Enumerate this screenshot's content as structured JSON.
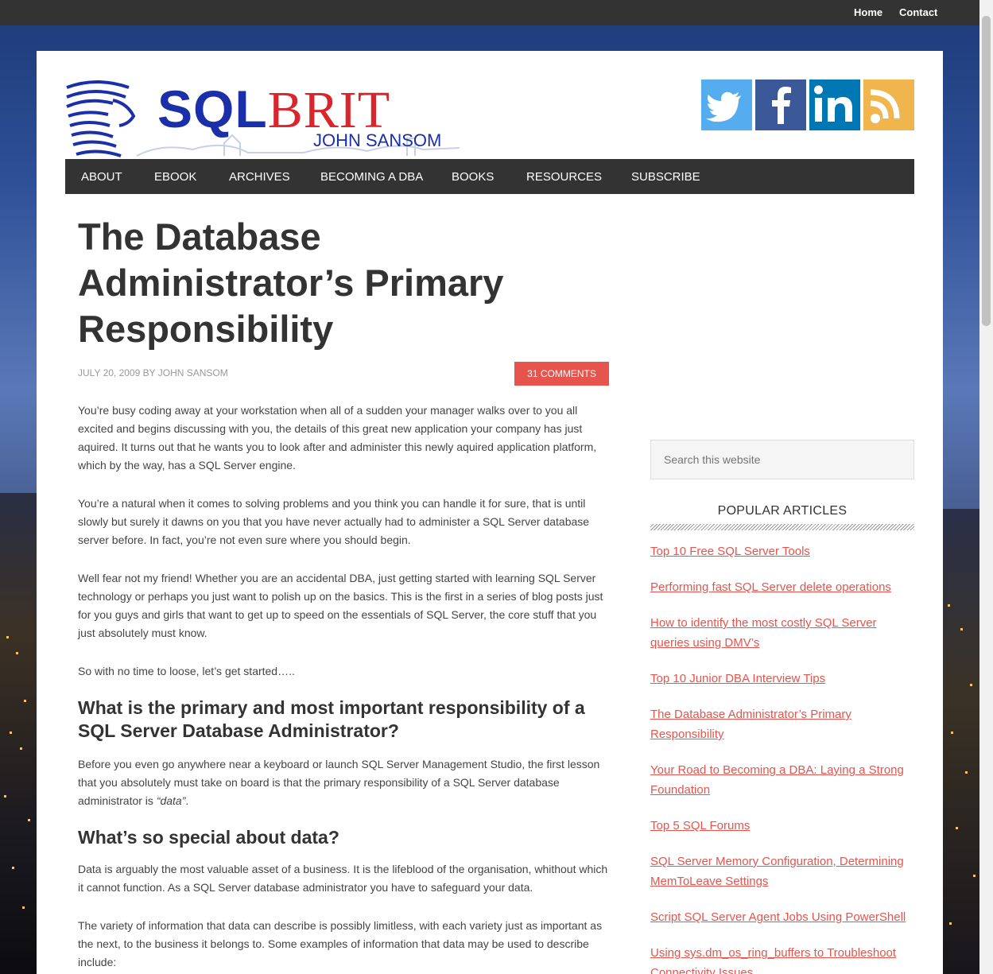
{
  "topbar": {
    "home": "Home",
    "contact": "Contact"
  },
  "header": {
    "logo_main_blue": "SQL",
    "logo_main_red": "BRIT",
    "logo_sub": "JOHN SANSOM",
    "social": [
      "twitter-icon",
      "facebook-icon",
      "linkedin-icon",
      "rss-icon"
    ],
    "colors": {
      "twitter": "#55acee",
      "facebook": "#3b5998",
      "linkedin": "#0077b5",
      "rss": "#f0b64d"
    }
  },
  "nav": [
    "ABOUT",
    "EBOOK",
    "ARCHIVES",
    "BECOMING A DBA",
    "BOOKS",
    "RESOURCES",
    "SUBSCRIBE"
  ],
  "post": {
    "title": "The Database Administrator’s Primary Responsibility",
    "meta": "JULY 20, 2009 BY JOHN SANSOM",
    "comments": "31 COMMENTS",
    "p1": "You’re busy coding away at your workstation when all of a sudden your manager walks over to you all excited and begins discussing with you, the details of this great new application your company has just aquired. It turns out that he wants you to look after and administer this newly aquired application platform, which by the way, has a SQL Server engine.",
    "p2": "You’re a natural when it comes to solving problems and you think you can handle it for sure, that is until slowly but surely it dawns on you that you have never actually had to administer a SQL Server database server before. In fact, you’re not even sure where you should begin.",
    "p3": "Well fear not my friend! Whether you are an accidental DBA, just getting started with learning SQL Server technology or perhaps you just want to polish up on the basics. This is the first in a series of blog posts just for you guys and girls that want to get up to speed on the essentials of SQL Server, the core stuff that you just absolutely must know.",
    "p4": "So with no time to loose, let’s get started…..",
    "h2a": "What is the primary and most important responsibility of a SQL Server Database Administrator?",
    "p5_start": "Before you even go anywhere near a keyboard or launch SQL Server Management Studio, the first lesson that you absolutely must take on board is that the primary responsibility of a SQL Server database administrator is ",
    "p5_em": "“data”",
    "p5_end": ".",
    "h2b": "What’s so special about data?",
    "p6": "Data is arguably the most valuable asset of a business. It is the lifeblood of the organisation, whithout which it cannot function. As a SQL Server database administrator you have to safeguard your data.",
    "p7": "The variety of information that data can describe is possibly limitless, with each variety just as important as the next, to the business it belongs to. Some examples of information that data may be used to describe include:"
  },
  "sidebar": {
    "search_placeholder": "Search this website",
    "widget_title": "POPULAR ARTICLES",
    "articles": [
      "Top 10 Free SQL Server Tools",
      "Performing fast SQL Server delete operations",
      "How to identify the most costly SQL Server queries using DMV’s",
      "Top 10 Junior DBA Interview Tips",
      "The Database Administrator’s Primary Responsibility",
      "Your Road to Becoming a DBA: Laying a Strong Foundation",
      "Top 5 SQL Forums",
      "SQL Server Memory Configuration, Determining MemToLeave Settings",
      "Script SQL Server Agent Jobs Using PowerShell",
      "Using sys.dm_os_ring_buffers to Troubleshoot Connectivity Issues"
    ]
  }
}
